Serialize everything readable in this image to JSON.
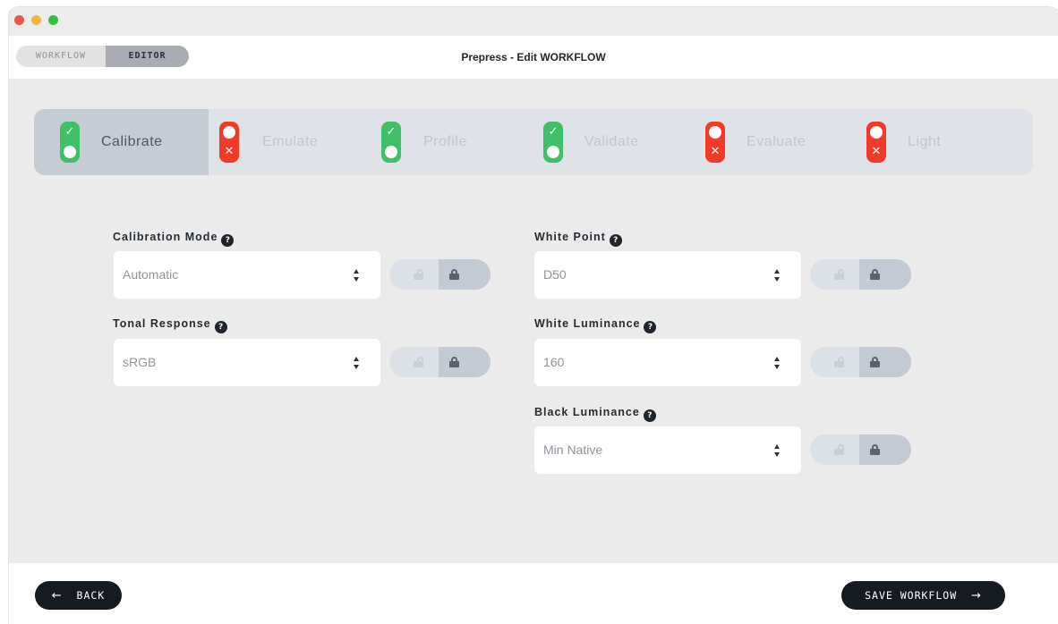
{
  "header": {
    "mode_toggle": {
      "workflow_label": "WORKFLOW",
      "editor_label": "EDITOR",
      "selected": "EDITOR"
    },
    "title": "Prepress - Edit WORKFLOW"
  },
  "steps": [
    {
      "label": "Calibrate",
      "status": "pass",
      "active": true
    },
    {
      "label": "Emulate",
      "status": "fail",
      "active": false
    },
    {
      "label": "Profile",
      "status": "pass",
      "active": false
    },
    {
      "label": "Validate",
      "status": "pass",
      "active": false
    },
    {
      "label": "Evaluate",
      "status": "fail",
      "active": false
    },
    {
      "label": "Light",
      "status": "fail",
      "active": false
    }
  ],
  "status_marks": {
    "pass": "✓",
    "fail": "✕"
  },
  "help_glyph": "?",
  "fields": {
    "calibration_mode": {
      "label": "Calibration Mode",
      "value": "Automatic",
      "locked": true
    },
    "tonal_response": {
      "label": "Tonal Response",
      "value": "sRGB",
      "locked": true
    },
    "white_point": {
      "label": "White Point",
      "value": "D50",
      "locked": true
    },
    "white_luminance": {
      "label": "White Luminance",
      "value": "160",
      "locked": true
    },
    "black_luminance": {
      "label": "Black Luminance",
      "value": "Min Native",
      "locked": true
    }
  },
  "footer": {
    "back_label": "BACK",
    "save_label": "SAVE WORKFLOW",
    "back_arrow": "←",
    "save_arrow": "→"
  },
  "colors": {
    "pass": "#3ec066",
    "fail": "#f23b26",
    "button_dark": "#161b21"
  }
}
